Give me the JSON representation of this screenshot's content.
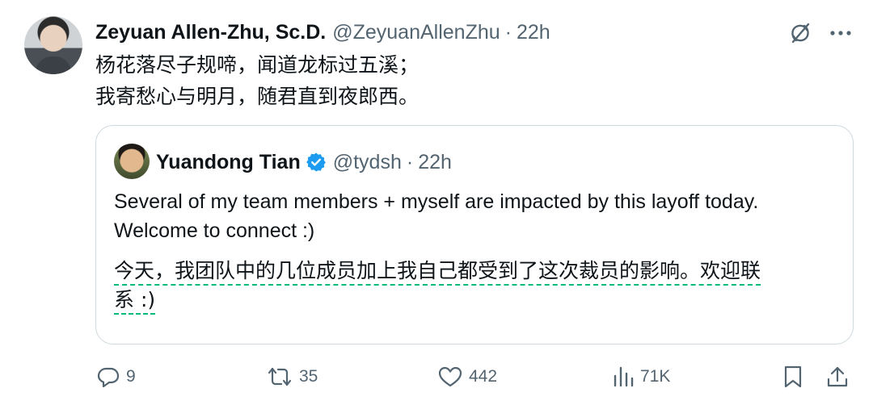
{
  "tweet": {
    "author": {
      "name": "Zeyuan Allen-Zhu, Sc.D.",
      "handle": "@ZeyuanAllenZhu",
      "time": "22h"
    },
    "separator": "·",
    "lines": [
      "杨花落尽子规啼，闻道龙标过五溪；",
      "我寄愁心与明月，随君直到夜郎西。"
    ],
    "quoted": {
      "name": "Yuandong Tian",
      "handle": "@tydsh",
      "time": "22h",
      "lines": [
        "Several of my team members + myself are impacted by this layoff today.",
        "Welcome to connect :)"
      ],
      "translation_lines": [
        "今天，我团队中的几位成员加上我自己都受到了这次裁员的影响。欢迎联",
        "系 :)"
      ]
    },
    "stats": {
      "replies": "9",
      "retweets": "35",
      "likes": "442",
      "views": "71K"
    }
  },
  "colors": {
    "text": "#0f1419",
    "muted": "#536471",
    "verified": "#1d9bf0",
    "translation_underline": "#00ba7c",
    "border": "#cfd9de"
  },
  "icons": {
    "grok": "grok-icon",
    "more": "more-icon",
    "reply": "reply-icon",
    "retweet": "retweet-icon",
    "like": "heart-icon",
    "views": "views-icon",
    "bookmark": "bookmark-icon",
    "share": "share-icon"
  }
}
